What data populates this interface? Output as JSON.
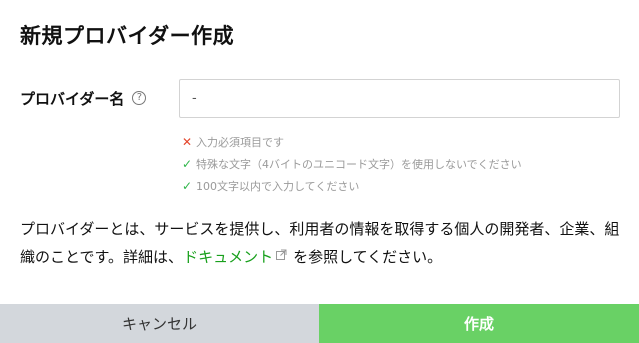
{
  "dialog": {
    "title": "新規プロバイダー作成"
  },
  "form": {
    "label": "プロバイダー名",
    "help_icon": "question-circle-icon",
    "input_value": "-"
  },
  "rules": [
    {
      "status": "error",
      "icon": "cross-icon",
      "text": "入力必須項目です"
    },
    {
      "status": "ok",
      "icon": "check-icon",
      "text": "特殊な文字（4バイトのユニコード文字）を使用しないでください"
    },
    {
      "status": "ok",
      "icon": "check-icon",
      "text": "100文字以内で入力してください"
    }
  ],
  "description": {
    "before_link": "プロバイダーとは、サービスを提供し、利用者の情報を取得する個人の開発者、企業、組織のことです。詳細は、",
    "link_text": "ドキュメント",
    "link_icon": "external-link-icon",
    "after_link": "を参照してください。"
  },
  "footer": {
    "cancel_label": "キャンセル",
    "create_label": "作成"
  },
  "colors": {
    "error": "#e4462c",
    "ok": "#2fb64a",
    "link": "#18a01c",
    "create_button": "#69d165",
    "cancel_button": "#d3d7dc"
  }
}
